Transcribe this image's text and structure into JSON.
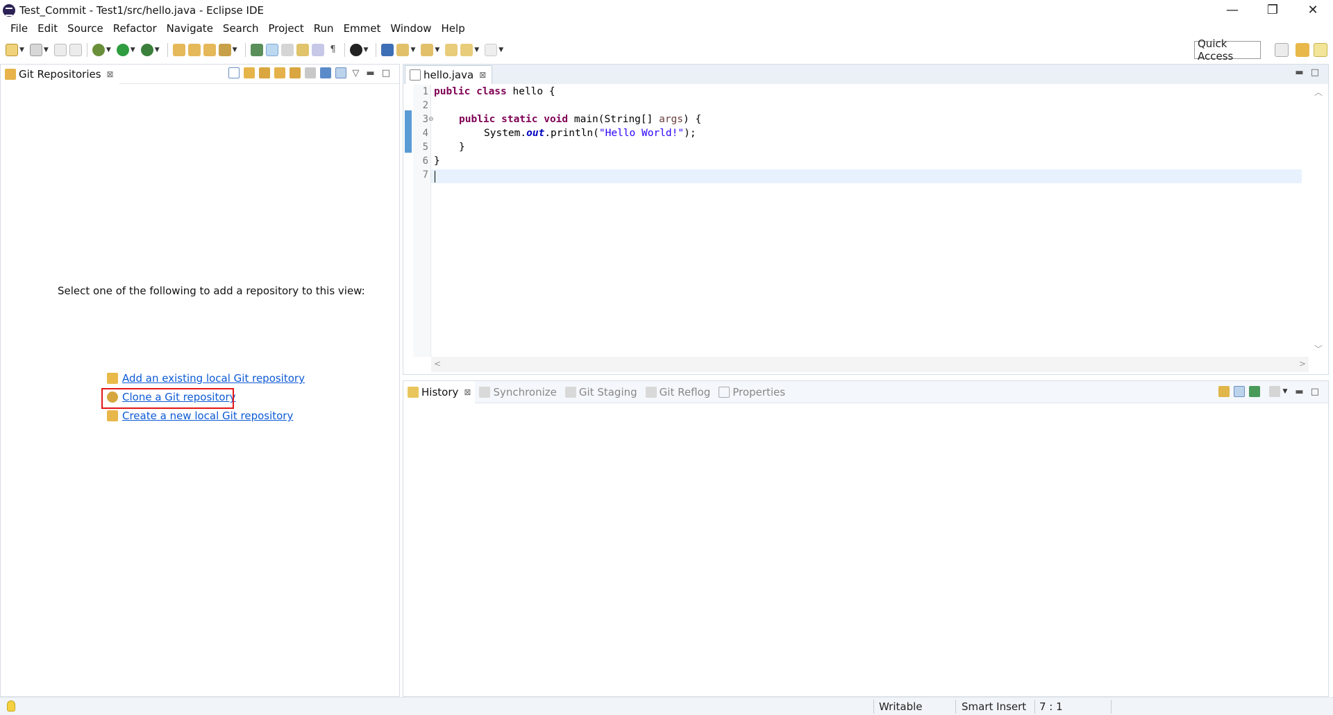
{
  "window": {
    "title": "Test_Commit - Test1/src/hello.java - Eclipse IDE",
    "controls": {
      "minimize": "—",
      "restore": "❐",
      "close": "✕"
    }
  },
  "menu": [
    "File",
    "Edit",
    "Source",
    "Refactor",
    "Navigate",
    "Search",
    "Project",
    "Run",
    "Emmet",
    "Window",
    "Help"
  ],
  "toolbar": {
    "quick_access_label": "Quick Access"
  },
  "git_repositories": {
    "tab_label": "Git Repositories",
    "prompt": "Select one of the following to add a repository to this view:",
    "links": {
      "add_existing": "Add an existing local Git repository",
      "clone": "Clone a Git repository",
      "create_new": "Create a new local Git repository"
    }
  },
  "editor": {
    "tab_label": "hello.java",
    "line_numbers": [
      "1",
      "2",
      "3",
      "4",
      "5",
      "6",
      "7"
    ],
    "code": {
      "l1_kw": "public class",
      "l1_rest": " hello {",
      "l3_kw": "public static void",
      "l3_rest": " main(String[] ",
      "l3_param": "args",
      "l3_end": ") {",
      "l4_pre": "System.",
      "l4_field": "out",
      "l4_mid": ".println(",
      "l4_str": "\"Hello World!\"",
      "l4_end": ");",
      "l5": "}",
      "l6": "}"
    }
  },
  "bottom_tabs": {
    "history": "History",
    "synchronize": "Synchronize",
    "git_staging": "Git Staging",
    "git_reflog": "Git Reflog",
    "properties": "Properties"
  },
  "status": {
    "writable": "Writable",
    "insert_mode": "Smart Insert",
    "cursor_position": "7 : 1"
  },
  "colors": {
    "link": "#0c5ad6",
    "highlight_box": "#e41616",
    "keyword": "#7f0055",
    "string": "#2a00ff"
  }
}
